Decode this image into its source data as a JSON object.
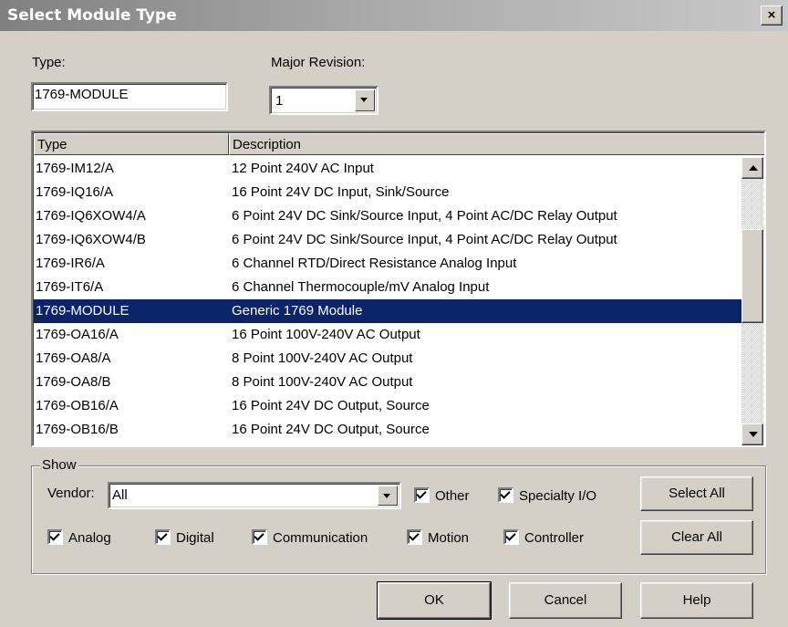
{
  "window": {
    "title": "Select Module Type",
    "close_label": "×"
  },
  "type_field": {
    "label": "Type:",
    "value": "1769-MODULE"
  },
  "revision": {
    "label": "Major Revision:",
    "value": "1"
  },
  "list": {
    "columns": [
      "Type",
      "Description"
    ],
    "rows": [
      {
        "type": "1769-IM12/A",
        "description": "12 Point 240V AC Input"
      },
      {
        "type": "1769-IQ16/A",
        "description": "16 Point 24V DC Input, Sink/Source"
      },
      {
        "type": "1769-IQ6XOW4/A",
        "description": "6 Point 24V DC Sink/Source Input, 4 Point AC/DC Relay Output"
      },
      {
        "type": "1769-IQ6XOW4/B",
        "description": "6 Point 24V DC Sink/Source Input, 4 Point AC/DC Relay Output"
      },
      {
        "type": "1769-IR6/A",
        "description": "6 Channel RTD/Direct Resistance Analog Input"
      },
      {
        "type": "1769-IT6/A",
        "description": "6 Channel Thermocouple/mV Analog Input"
      },
      {
        "type": "1769-MODULE",
        "description": "Generic 1769 Module"
      },
      {
        "type": "1769-OA16/A",
        "description": "16 Point 100V-240V AC Output"
      },
      {
        "type": "1769-OA8/A",
        "description": "8 Point 100V-240V AC Output"
      },
      {
        "type": "1769-OA8/B",
        "description": "8 Point 100V-240V AC Output"
      },
      {
        "type": "1769-OB16/A",
        "description": "16 Point 24V DC Output, Source"
      },
      {
        "type": "1769-OB16/B",
        "description": "16 Point 24V DC Output, Source"
      }
    ],
    "selected_index": 6
  },
  "show": {
    "legend": "Show",
    "vendor_label": "Vendor:",
    "vendor_value": "All",
    "filters": {
      "other": "Other",
      "specialty": "Specialty I/O",
      "analog": "Analog",
      "digital": "Digital",
      "communication": "Communication",
      "motion": "Motion",
      "controller": "Controller"
    },
    "select_all": "Select All",
    "clear_all": "Clear All"
  },
  "buttons": {
    "ok": "OK",
    "cancel": "Cancel",
    "help": "Help"
  },
  "colors": {
    "selection": "#0a246a",
    "dialog_bg": "#d4d0c8"
  }
}
